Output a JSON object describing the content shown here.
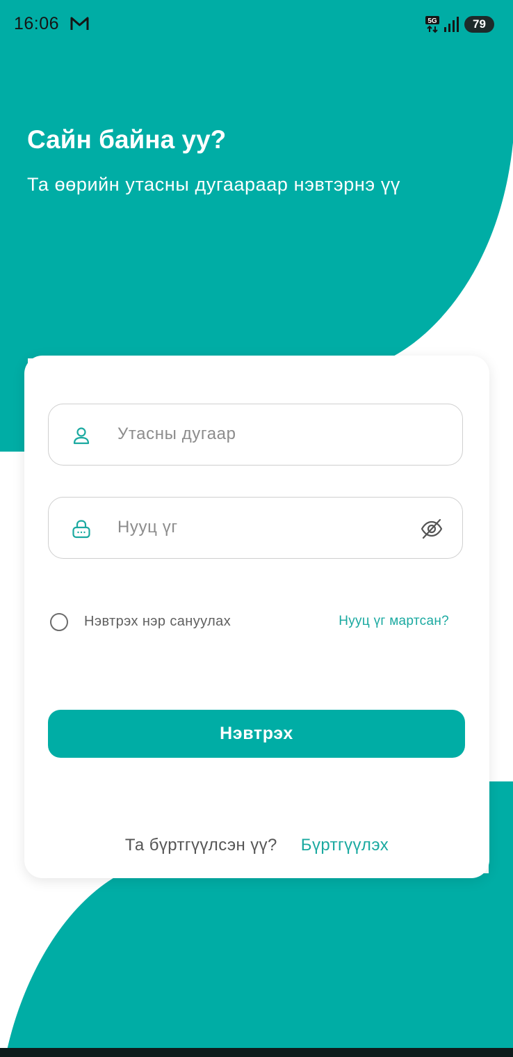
{
  "status_bar": {
    "time": "16:06",
    "mail_icon": "gmail-icon",
    "network_label": "5G",
    "battery_level": "79"
  },
  "header": {
    "title": "Сайн байна уу?",
    "subtitle": "Та өөрийн утасны дугаараар нэвтэрнэ үү"
  },
  "form": {
    "phone": {
      "placeholder": "Утасны дугаар",
      "value": "",
      "icon": "user-icon"
    },
    "password": {
      "placeholder": "Нууц үг",
      "value": "",
      "icon": "lock-icon",
      "toggle_icon": "eye-off-icon"
    },
    "remember_label": "Нэвтрэх нэр сануулах",
    "remember_checked": false,
    "forgot_label": "Нууц үг мартсан?",
    "submit_label": "Нэвтрэх"
  },
  "footer": {
    "question": "Та бүртгүүлсэн үү?",
    "register_label": "Бүртгүүлэх"
  },
  "colors": {
    "accent": "#00ada5",
    "link": "#1aa9a0",
    "background": "#ffffff"
  }
}
